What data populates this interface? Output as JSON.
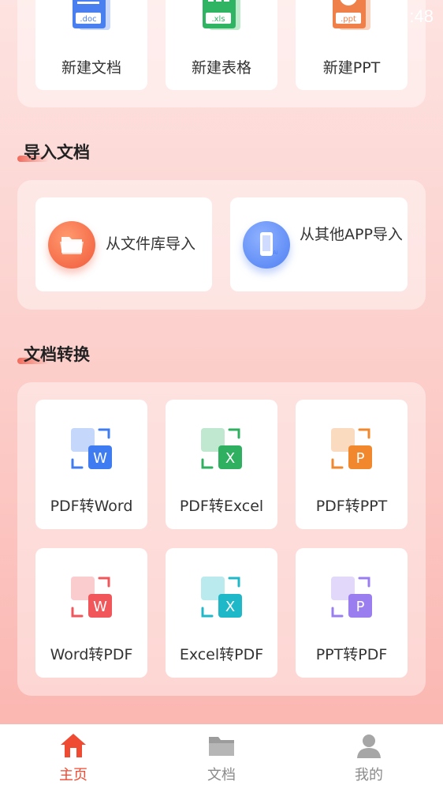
{
  "status_bar": {
    "time": ":48"
  },
  "create_section": {
    "items": [
      {
        "label": "新建文档",
        "icon_text": ".doc",
        "color": "#4a7ff0"
      },
      {
        "label": "新建表格",
        "icon_text": ".xls",
        "color": "#2eb463"
      },
      {
        "label": "新建PPT",
        "icon_text": ".ppt",
        "color": "#f0804a"
      }
    ]
  },
  "import_section": {
    "title": "导入文档",
    "items": [
      {
        "label": "从文件库导入",
        "icon": "folder-icon",
        "color": "#f36b4f"
      },
      {
        "label": "从其他APP导入",
        "icon": "phone-app-icon",
        "color": "#4f7ff2"
      }
    ]
  },
  "convert_section": {
    "title": "文档转换",
    "items": [
      {
        "label": "PDF转Word",
        "badge": "W",
        "color": "#3f7cf2"
      },
      {
        "label": "PDF转Excel",
        "badge": "X",
        "color": "#2fb060"
      },
      {
        "label": "PDF转PPT",
        "badge": "P",
        "color": "#f2882e"
      },
      {
        "label": "Word转PDF",
        "badge": "W",
        "color": "#f0565a"
      },
      {
        "label": "Excel转PDF",
        "badge": "X",
        "color": "#1fb8c8"
      },
      {
        "label": "PPT转PDF",
        "badge": "P",
        "color": "#9a7ef0"
      }
    ]
  },
  "tabbar": {
    "items": [
      {
        "label": "主页",
        "active": true
      },
      {
        "label": "文档",
        "active": false
      },
      {
        "label": "我的",
        "active": false
      }
    ],
    "active_color": "#ef4a32",
    "inactive_color": "#8a8a8a"
  }
}
